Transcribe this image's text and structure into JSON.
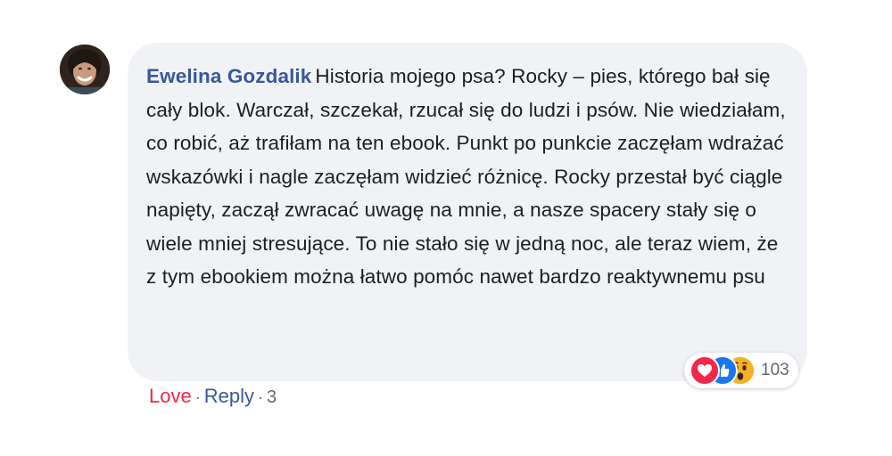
{
  "comment": {
    "author": "Ewelina Gozdalik",
    "text": "Historia mojego psa? Rocky – pies, którego bał się cały blok. Warczał, szczekał, rzucał się do ludzi i psów. Nie wiedziałam, co robić, aż trafiłam na ten ebook. Punkt po punkcie zaczęłam wdrażać wskazówki i nagle zaczęłam widzieć różnicę. Rocky przestał być ciągle napięty, zaczął zwracać uwagę na mnie, a nasze spacery stały się o wiele mniej stresujące. To nie stało się w jedną noc, ale teraz wiem, że z tym ebookiem można łatwo pomóc nawet bardzo reaktywnemu psu"
  },
  "reactions": {
    "icons": [
      "love-icon",
      "like-icon",
      "wow-icon"
    ],
    "count": "103"
  },
  "actions": {
    "love_label": "Love",
    "reply_label": "Reply",
    "separator": "·",
    "time": "3"
  },
  "colors": {
    "author": "#385898",
    "love": "#f0284a",
    "bubble": "#f1f2f6",
    "text": "#1c1e21",
    "meta": "#606770"
  }
}
